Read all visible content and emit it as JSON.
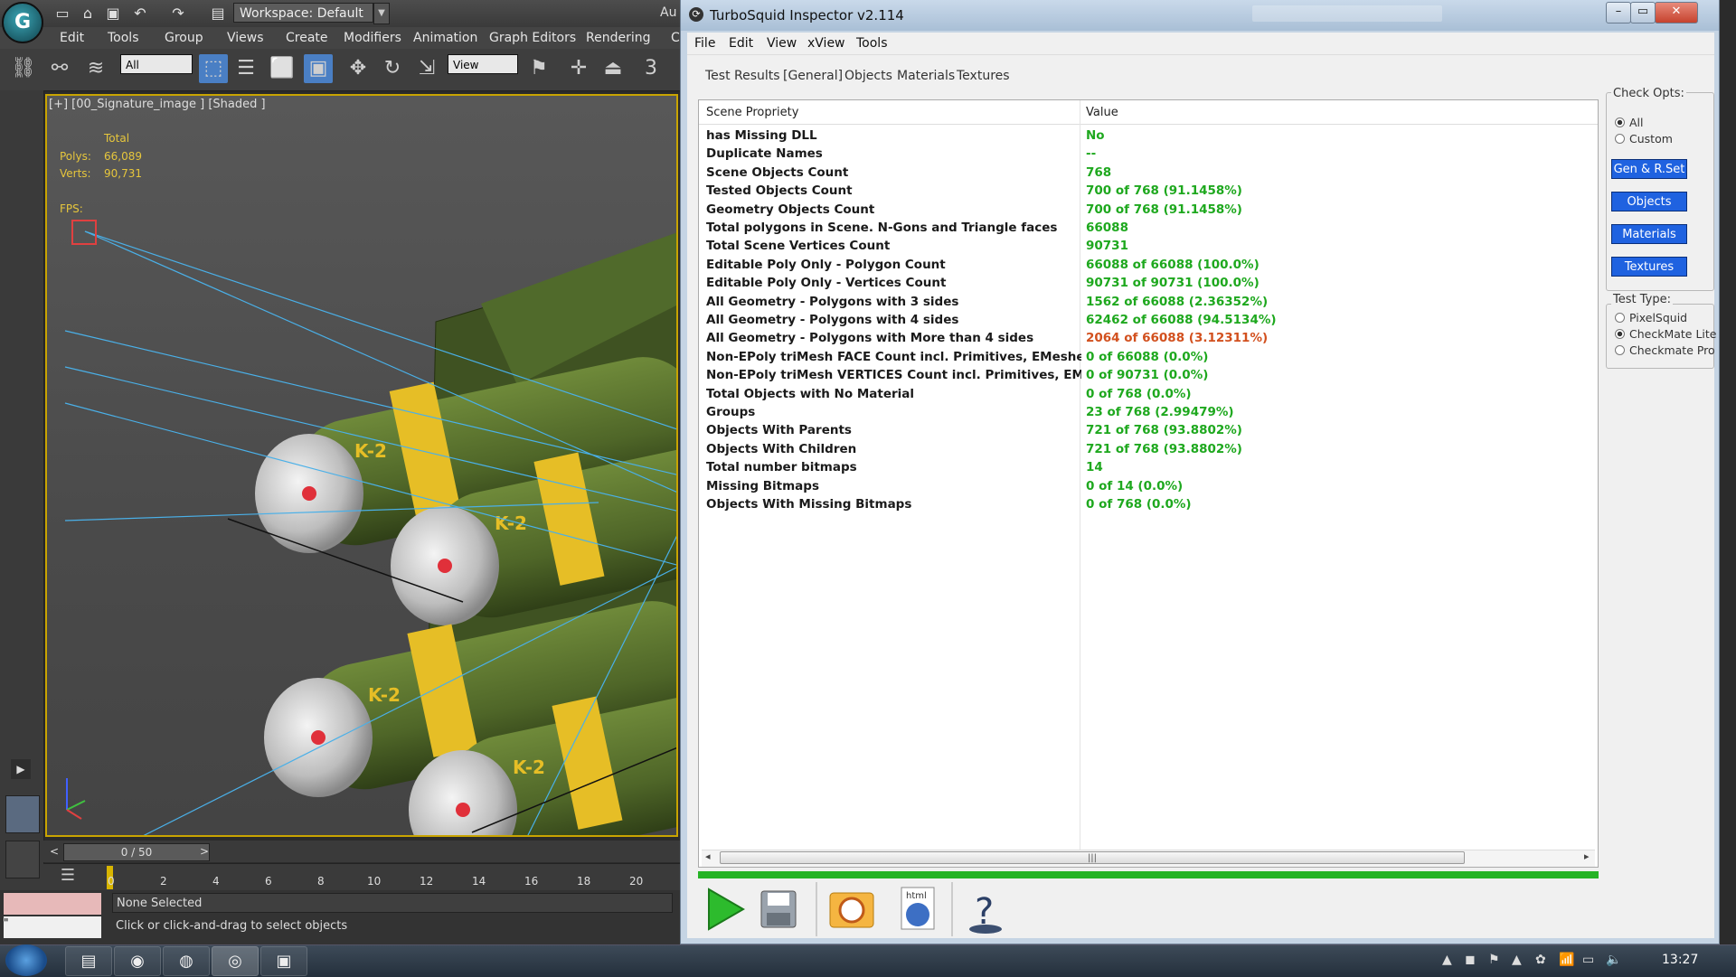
{
  "max": {
    "logo_glyph": "G",
    "workspace": "Workspace: Default",
    "menus": [
      "Edit",
      "Tools",
      "Group",
      "Views",
      "Create",
      "Modifiers",
      "Animation",
      "Graph Editors",
      "Rendering",
      "C"
    ],
    "title_fragment": "Au",
    "selection_filter": "All",
    "ref_coord": "View",
    "snap_label": "3",
    "viewport_label": "[+] [00_Signature_image ] [Shaded ]",
    "stats": {
      "total_label": "Total",
      "polys_label": "Polys:",
      "polys_value": "66,089",
      "verts_label": "Verts:",
      "verts_value": "90,731",
      "fps_label": "FPS:"
    },
    "bomb_label": "K-2",
    "time_slider": "0 / 50",
    "time_prev": "<",
    "time_next": ">",
    "ticks": [
      "0",
      "2",
      "4",
      "6",
      "8",
      "10",
      "12",
      "14",
      "16",
      "18",
      "20"
    ],
    "status_selected": "None Selected",
    "status_prompt": "Click or click-and-drag to select objects",
    "status_box2": "\""
  },
  "inspector": {
    "title": "TurboSquid Inspector v2.114",
    "window_buttons": [
      "–",
      "▭",
      "✕"
    ],
    "menus": [
      "File",
      "Edit",
      "View",
      "xView",
      "Tools"
    ],
    "tabs": [
      "Test Results",
      "[General]",
      "Objects",
      "Materials",
      "Textures"
    ],
    "columns": [
      "Scene Propriety",
      "Value"
    ],
    "rows": [
      {
        "key": "has Missing DLL",
        "value": "No",
        "color": "#1ea81e"
      },
      {
        "key": "Duplicate Names",
        "value": "--",
        "color": "#1ea81e"
      },
      {
        "key": "Scene Objects Count",
        "value": "768",
        "color": "#1ea81e"
      },
      {
        "key": "Tested Objects Count",
        "value": "700 of 768 (91.1458%)",
        "color": "#1ea81e"
      },
      {
        "key": "Geometry Objects Count",
        "value": "700 of 768 (91.1458%)",
        "color": "#1ea81e"
      },
      {
        "key": "Total polygons in Scene. N-Gons and Triangle faces",
        "value": "66088",
        "color": "#1ea81e"
      },
      {
        "key": "Total Scene Vertices Count",
        "value": "90731",
        "color": "#1ea81e"
      },
      {
        "key": "Editable Poly Only - Polygon Count",
        "value": "66088 of 66088 (100.0%)",
        "color": "#1ea81e"
      },
      {
        "key": "Editable Poly Only - Vertices Count",
        "value": "90731 of 90731 (100.0%)",
        "color": "#1ea81e"
      },
      {
        "key": "All Geometry - Polygons with 3 sides",
        "value": "1562 of 66088 (2.36352%)",
        "color": "#1ea81e"
      },
      {
        "key": "All Geometry - Polygons with 4 sides",
        "value": "62462 of 66088 (94.5134%)",
        "color": "#1ea81e"
      },
      {
        "key": "All Geometry - Polygons with More than 4 sides",
        "value": "2064 of 66088 (3.12311%)",
        "color": "#d2501e"
      },
      {
        "key": "Non-EPoly triMesh FACE Count incl. Primitives, EMeshes etc...",
        "value": "0 of 66088 (0.0%)",
        "color": "#1ea81e"
      },
      {
        "key": "Non-EPoly triMesh VERTICES Count incl. Primitives, EMeshes ...",
        "value": "0 of 90731 (0.0%)",
        "color": "#1ea81e"
      },
      {
        "key": "Total Objects with No Material",
        "value": "0 of 768 (0.0%)",
        "color": "#1ea81e"
      },
      {
        "key": "Groups",
        "value": "23 of 768 (2.99479%)",
        "color": "#1ea81e"
      },
      {
        "key": "Objects With Parents",
        "value": "721 of 768 (93.8802%)",
        "color": "#1ea81e"
      },
      {
        "key": "Objects With Children",
        "value": "721 of 768 (93.8802%)",
        "color": "#1ea81e"
      },
      {
        "key": "Total number bitmaps",
        "value": "14",
        "color": "#1ea81e"
      },
      {
        "key": "Missing Bitmaps",
        "value": "0 of 14 (0.0%)",
        "color": "#1ea81e"
      },
      {
        "key": "Objects With Missing Bitmaps",
        "value": "0 of 768 (0.0%)",
        "color": "#1ea81e"
      }
    ],
    "scroll_left": "◂",
    "scroll_right": "▸",
    "scroll_grip": "|||",
    "check_opts": {
      "label": "Check Opts:",
      "options": [
        "All",
        "Custom"
      ],
      "selected": "All",
      "buttons": [
        "Gen & R.Set",
        "Objects",
        "Materials",
        "Textures"
      ]
    },
    "test_type": {
      "label": "Test Type:",
      "options": [
        "PixelSquid",
        "CheckMate Lite",
        "Checkmate Pro"
      ],
      "selected": "CheckMate Lite"
    },
    "toolbar_icons": [
      "play-icon",
      "save-icon",
      "max-icon",
      "html-globe-icon",
      "help-icon"
    ],
    "html_icon_text": "html",
    "help_glyph": "?"
  },
  "taskbar": {
    "clock": "13:27",
    "apps": [
      "file-explorer-icon",
      "firefox-icon",
      "chrome-icon",
      "max-icon",
      "chat-icon"
    ]
  }
}
